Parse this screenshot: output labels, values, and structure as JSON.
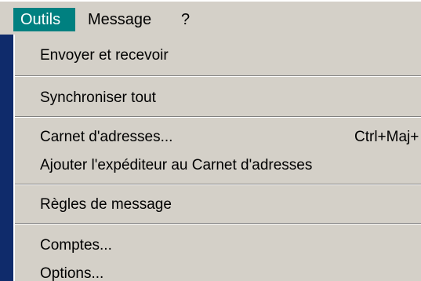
{
  "menubar": {
    "items": [
      {
        "label": "Outils",
        "active": true
      },
      {
        "label": "Message",
        "active": false
      },
      {
        "label": "?",
        "active": false
      }
    ]
  },
  "dropdown": {
    "items": [
      {
        "label": "Envoyer et recevoir",
        "shortcut": ""
      },
      {
        "label": "Synchroniser tout",
        "shortcut": ""
      },
      {
        "label": "Carnet d'adresses...",
        "shortcut": "Ctrl+Maj+"
      },
      {
        "label": "Ajouter l'expéditeur au Carnet d'adresses",
        "shortcut": ""
      },
      {
        "label": "Règles de message",
        "shortcut": ""
      },
      {
        "label": "Comptes...",
        "shortcut": ""
      },
      {
        "label": "Options...",
        "shortcut": ""
      }
    ]
  },
  "colors": {
    "desktop": "#0f2b6b",
    "menu_background": "#d4d0c8",
    "highlight": "#008080",
    "highlight_text": "#ffffff",
    "text": "#000000"
  }
}
